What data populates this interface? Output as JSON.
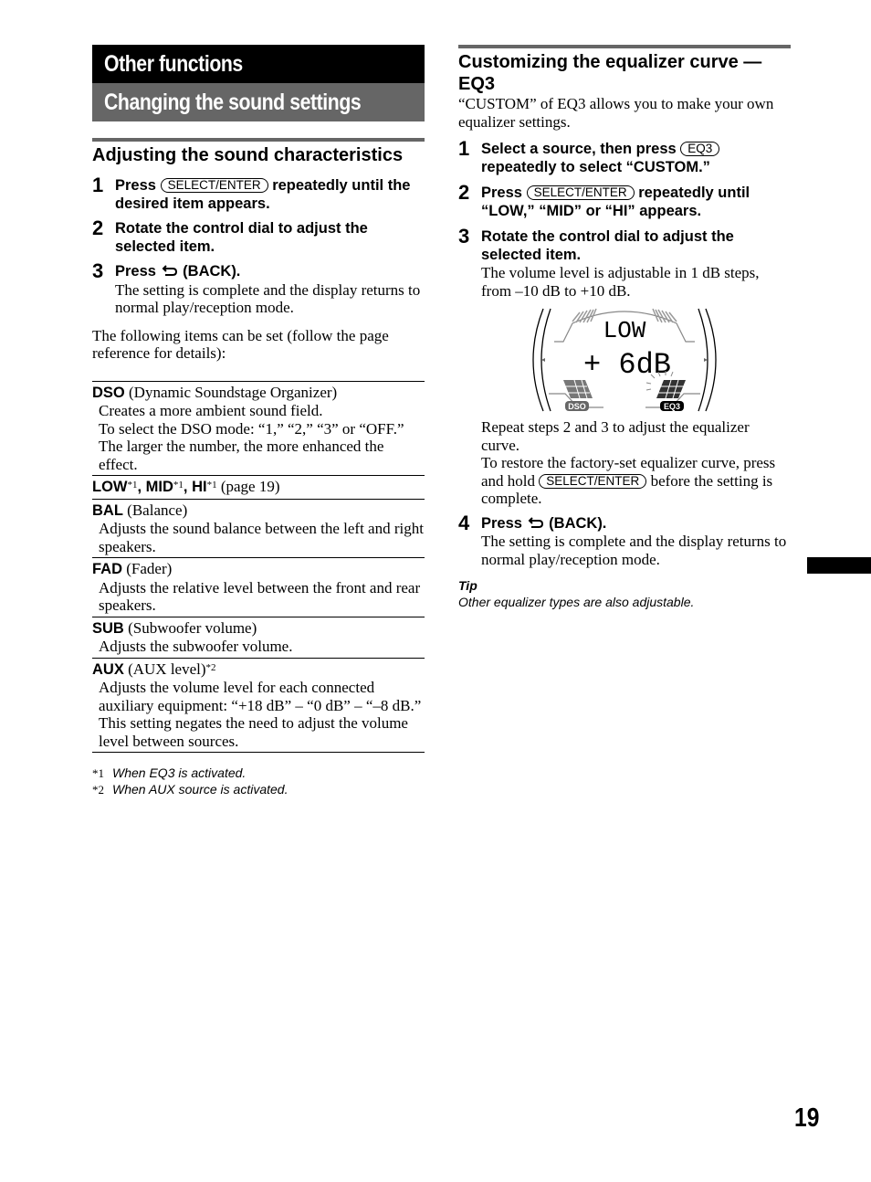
{
  "header": {
    "chapter": "Other functions",
    "section": "Changing the sound settings"
  },
  "left": {
    "heading": "Adjusting the sound characteristics",
    "steps": [
      {
        "num": "1",
        "pre": "Press",
        "key": "SELECT/ENTER",
        "post": "repeatedly until the desired item appears."
      },
      {
        "num": "2",
        "title": "Rotate the control dial to adjust the selected item."
      },
      {
        "num": "3",
        "pre": "Press",
        "icon": "back-arrow-icon",
        "post": "(BACK).",
        "body": "The setting is complete and the display returns to normal play/reception mode."
      }
    ],
    "intro": "The following items can be set (follow the page reference for details):",
    "items": [
      {
        "name": "DSO",
        "desc": "(Dynamic Soundstage Organizer)",
        "lines": [
          "Creates a more ambient sound field.",
          "To select the DSO mode: “1,” “2,” “3” or “OFF.”",
          "The larger the number, the more enhanced the effect."
        ]
      },
      {
        "name": "LOW",
        "sup1": "*1",
        "name2": "MID",
        "sup2": "*1",
        "name3": "HI",
        "sup3": "*1",
        "desc": "(page 19)",
        "lines": []
      },
      {
        "name": "BAL",
        "desc": "(Balance)",
        "lines": [
          "Adjusts the sound balance between the left and right speakers."
        ]
      },
      {
        "name": "FAD",
        "desc": "(Fader)",
        "lines": [
          "Adjusts the relative level between the front and rear speakers."
        ]
      },
      {
        "name": "SUB",
        "desc": "(Subwoofer volume)",
        "lines": [
          "Adjusts the subwoofer volume."
        ]
      },
      {
        "name": "AUX",
        "desc": "(AUX level)",
        "sup": "*2",
        "lines": [
          "Adjusts the volume level for each connected auxiliary equipment: “+18 dB” – “0 dB” – “–8 dB.”",
          "This setting negates the need to adjust the volume level between sources."
        ]
      }
    ],
    "footnotes": [
      {
        "mark": "*1",
        "text": "When EQ3 is activated."
      },
      {
        "mark": "*2",
        "text": "When AUX source is activated."
      }
    ]
  },
  "right": {
    "heading": "Customizing the equalizer curve — EQ3",
    "intro": "“CUSTOM” of EQ3 allows you to make your own equalizer settings.",
    "steps": [
      {
        "num": "1",
        "pre": "Select a source, then press",
        "key": "EQ3",
        "post": "repeatedly to select “CUSTOM.”"
      },
      {
        "num": "2",
        "pre": "Press",
        "key": "SELECT/ENTER",
        "post": "repeatedly until “LOW,” “MID” or “HI” appears."
      },
      {
        "num": "3",
        "title": "Rotate the control dial to adjust the selected item.",
        "body": "The volume level is adjustable in 1 dB steps, from –10 dB to +10 dB."
      },
      {
        "num": "4",
        "pre": "Press",
        "icon": "back-arrow-icon",
        "post": "(BACK).",
        "body": "The setting is complete and the display returns to normal play/reception mode."
      }
    ],
    "display": {
      "line1": "LOW",
      "line2": "+ 6dB",
      "left_badge": "DSO",
      "right_badge": "EQ3"
    },
    "after_display": {
      "line1": "Repeat steps 2 and 3 to adjust the equalizer curve.",
      "line2_pre": "To restore the factory-set equalizer curve, press and hold",
      "line2_key": "SELECT/ENTER",
      "line2_post": "before the setting is complete."
    },
    "tip": {
      "label": "Tip",
      "text": "Other equalizer types are also adjustable."
    }
  },
  "page_number": "19"
}
